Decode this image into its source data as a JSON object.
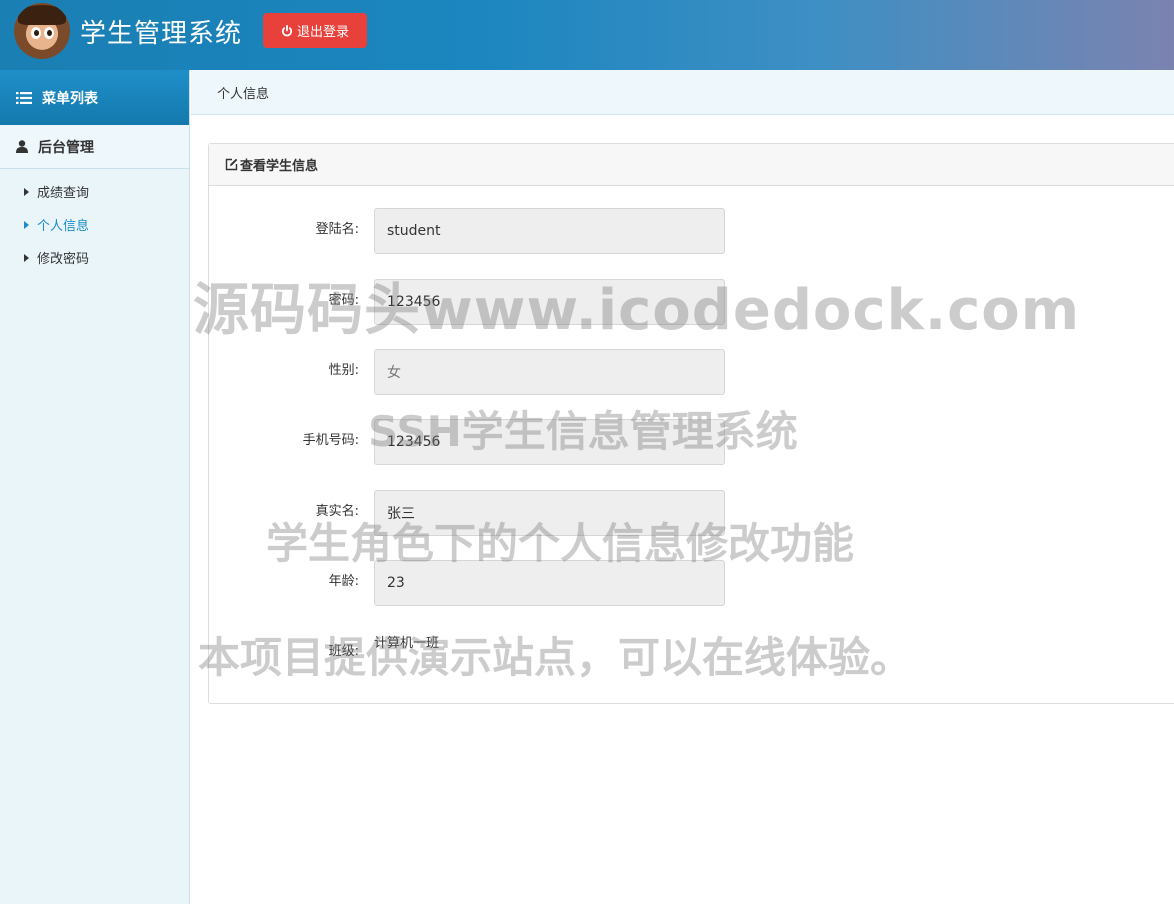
{
  "header": {
    "app_title": "学生管理系统",
    "logout_label": "退出登录"
  },
  "sidebar": {
    "menu_title": "菜单列表",
    "section_title": "后台管理",
    "items": [
      {
        "label": "成绩查询",
        "active": false
      },
      {
        "label": "个人信息",
        "active": true
      },
      {
        "label": "修改密码",
        "active": false
      }
    ]
  },
  "breadcrumb": "个人信息",
  "panel": {
    "title": "查看学生信息",
    "fields": [
      {
        "label": "登陆名:",
        "value": "student"
      },
      {
        "label": "密码:",
        "value": "123456"
      },
      {
        "label": "性别:",
        "value": "女"
      },
      {
        "label": "手机号码:",
        "value": "123456"
      },
      {
        "label": "真实名:",
        "value": "张三"
      },
      {
        "label": "年龄:",
        "value": "23"
      },
      {
        "label": "班级:",
        "value": "计算机一班"
      }
    ]
  },
  "watermarks": [
    "源码码头www.icodedock.com",
    "SSH学生信息管理系统",
    "学生角色下的个人信息修改功能",
    "本项目提供演示站点，可以在线体验。"
  ],
  "colors": {
    "accent": "#1b8cc6",
    "logout_button": "#e8403b",
    "sidebar_bg": "#eaf5fa"
  }
}
